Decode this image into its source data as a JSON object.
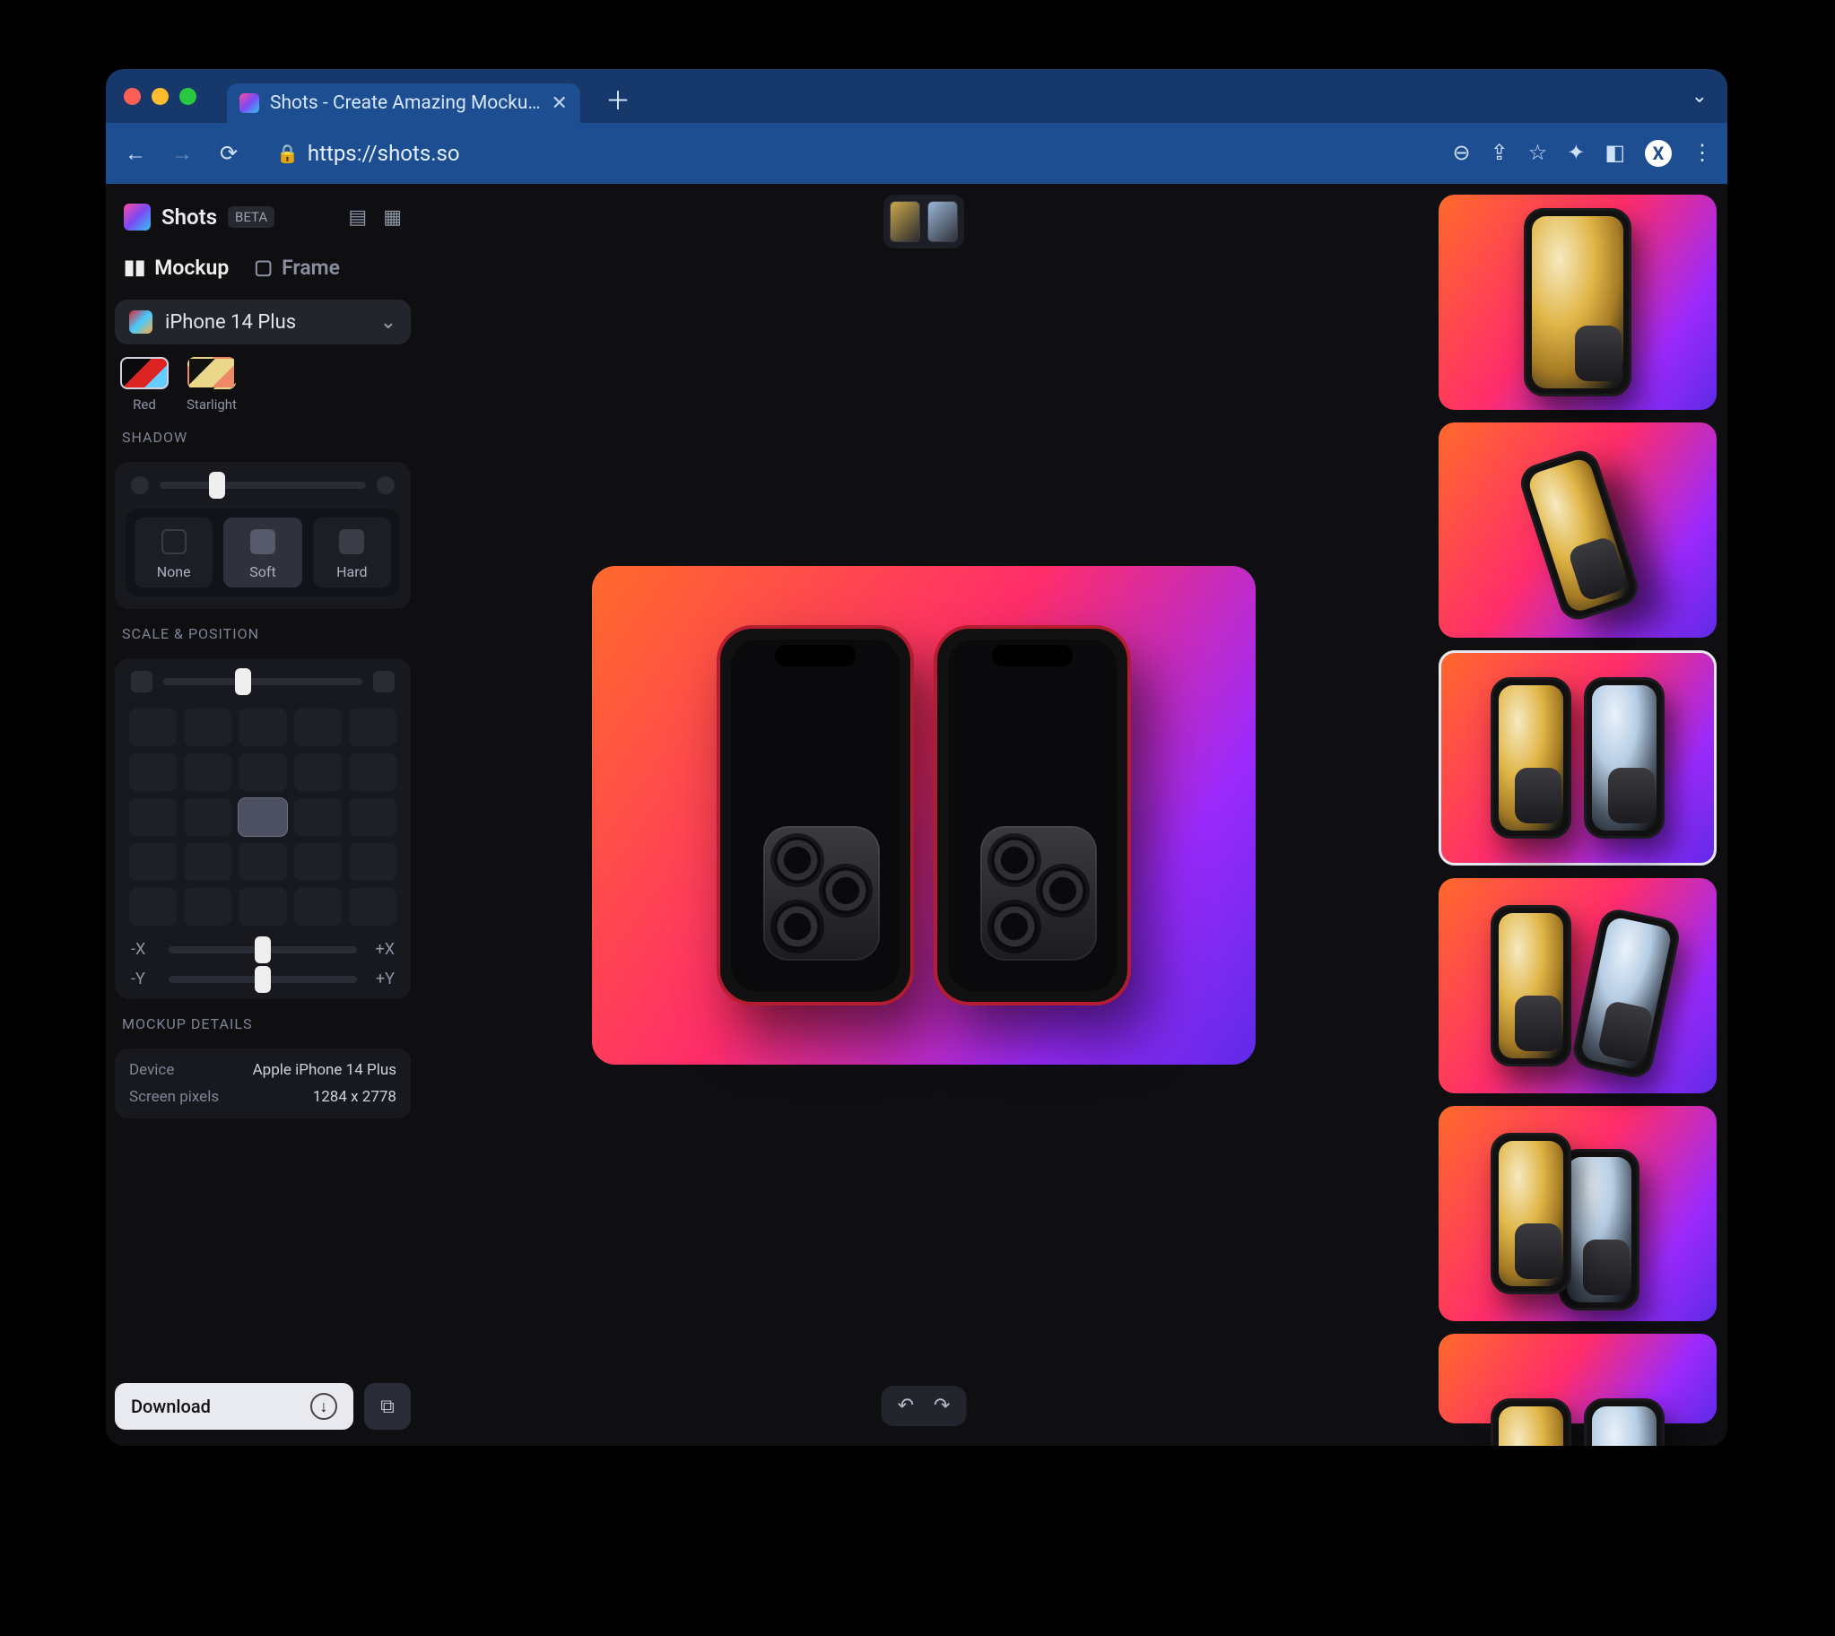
{
  "browser": {
    "tab_title": "Shots - Create Amazing Mocku…",
    "url": "https://shots.so"
  },
  "app": {
    "brand": "Shots",
    "badge": "BETA",
    "tabs": {
      "mockup": "Mockup",
      "frame": "Frame",
      "active": "mockup"
    },
    "device_select": "iPhone 14 Plus",
    "colors": [
      {
        "id": "red",
        "label": "Red",
        "selected": true
      },
      {
        "id": "starlight",
        "label": "Starlight",
        "selected": false
      }
    ],
    "sections": {
      "shadow": {
        "title": "SHADOW",
        "value_pct": 28,
        "options": [
          {
            "id": "none",
            "label": "None",
            "selected": false
          },
          {
            "id": "soft",
            "label": "Soft",
            "selected": true
          },
          {
            "id": "hard",
            "label": "Hard",
            "selected": false
          }
        ]
      },
      "scale_position": {
        "title": "SCALE & POSITION",
        "scale_pct": 40,
        "grid_selected_index": 12,
        "x": {
          "minus": "-X",
          "plus": "+X",
          "value_pct": 50
        },
        "y": {
          "minus": "-Y",
          "plus": "+Y",
          "value_pct": 50
        }
      },
      "details": {
        "title": "MOCKUP DETAILS",
        "rows": [
          {
            "k": "Device",
            "v": "Apple iPhone 14 Plus"
          },
          {
            "k": "Screen pixels",
            "v": "1284 x 2778"
          }
        ]
      }
    },
    "download_label": "Download",
    "presets_selected_index": 2
  }
}
